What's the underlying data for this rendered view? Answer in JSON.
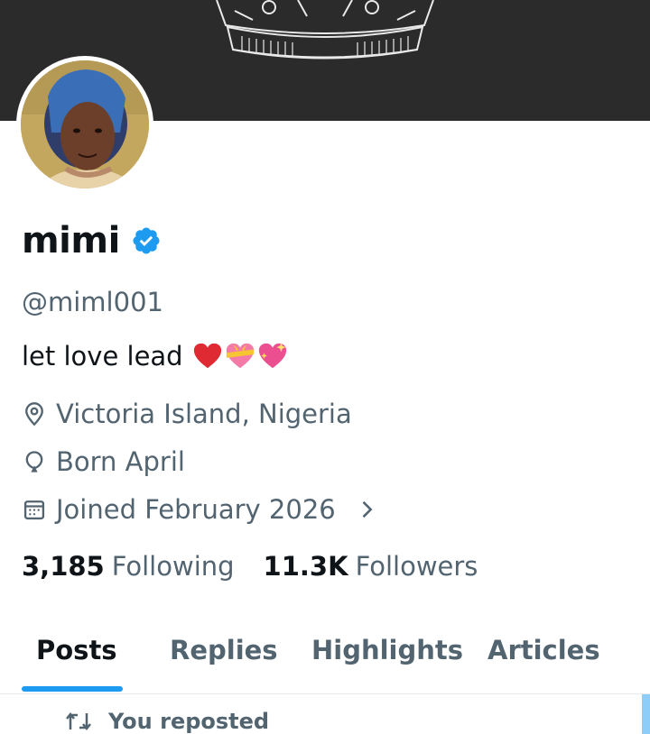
{
  "profile": {
    "display_name": "mimi",
    "handle": "@miml001",
    "bio_text": "let love lead",
    "bio_emojis": [
      "red-heart",
      "heart-with-ribbon",
      "sparkling-heart"
    ],
    "verified_badge_color": "#1d9bf0"
  },
  "details": {
    "location": "Victoria Island, Nigeria",
    "birthday": "Born April",
    "joined": "Joined February 2026"
  },
  "stats": {
    "following_count": "3,185",
    "following_label": "Following",
    "followers_count": "11.3K",
    "followers_label": "Followers"
  },
  "tabs": [
    {
      "label": "Posts",
      "active": true
    },
    {
      "label": "Replies",
      "active": false
    },
    {
      "label": "Highlights",
      "active": false
    },
    {
      "label": "Articles",
      "active": false
    }
  ],
  "feed": {
    "repost_text": "You reposted"
  },
  "colors": {
    "accent": "#1d9bf0",
    "text_primary": "#0f1419",
    "text_secondary": "#536471",
    "banner": "#2b2b2b"
  },
  "icons": {
    "location": "location-pin-icon",
    "birthday": "balloon-icon",
    "joined": "calendar-icon",
    "repost": "repost-icon"
  }
}
